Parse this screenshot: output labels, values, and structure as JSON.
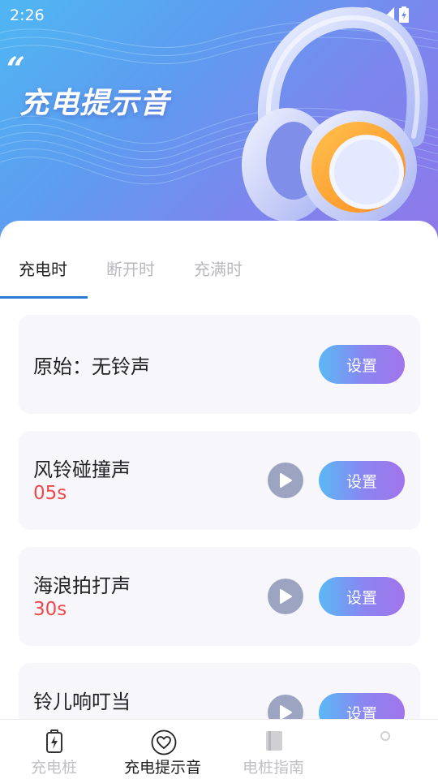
{
  "status_bar": {
    "time": "2:26"
  },
  "hero": {
    "quote": "“",
    "title": "充电提示音"
  },
  "tabs": [
    {
      "label": "充电时",
      "active": true
    },
    {
      "label": "断开时",
      "active": false
    },
    {
      "label": "充满时",
      "active": false
    }
  ],
  "rows": [
    {
      "title": "原始：无铃声",
      "duration": "",
      "playable": false,
      "button": "设置"
    },
    {
      "title": "风铃碰撞声",
      "duration": "05s",
      "playable": true,
      "button": "设置"
    },
    {
      "title": "海浪拍打声",
      "duration": "30s",
      "playable": true,
      "button": "设置"
    },
    {
      "title": "铃儿响叮当",
      "duration": "",
      "playable": true,
      "button": "设置"
    }
  ],
  "bottom_nav": [
    {
      "label": "充电桩",
      "icon": "battery-charging-icon",
      "active": false
    },
    {
      "label": "充电提示音",
      "icon": "heart-icon",
      "active": true
    },
    {
      "label": "电桩指南",
      "icon": "book-icon",
      "active": false
    },
    {
      "label": "",
      "icon": "person-icon",
      "active": false
    }
  ],
  "colors": {
    "accent_blue": "#2c7ad6",
    "duration_red": "#f0474a",
    "button_gradient_start": "#5ab8f6",
    "button_gradient_end": "#a274ea",
    "hero_gradient_start": "#4fb7f2",
    "hero_gradient_end": "#8f77ea"
  }
}
